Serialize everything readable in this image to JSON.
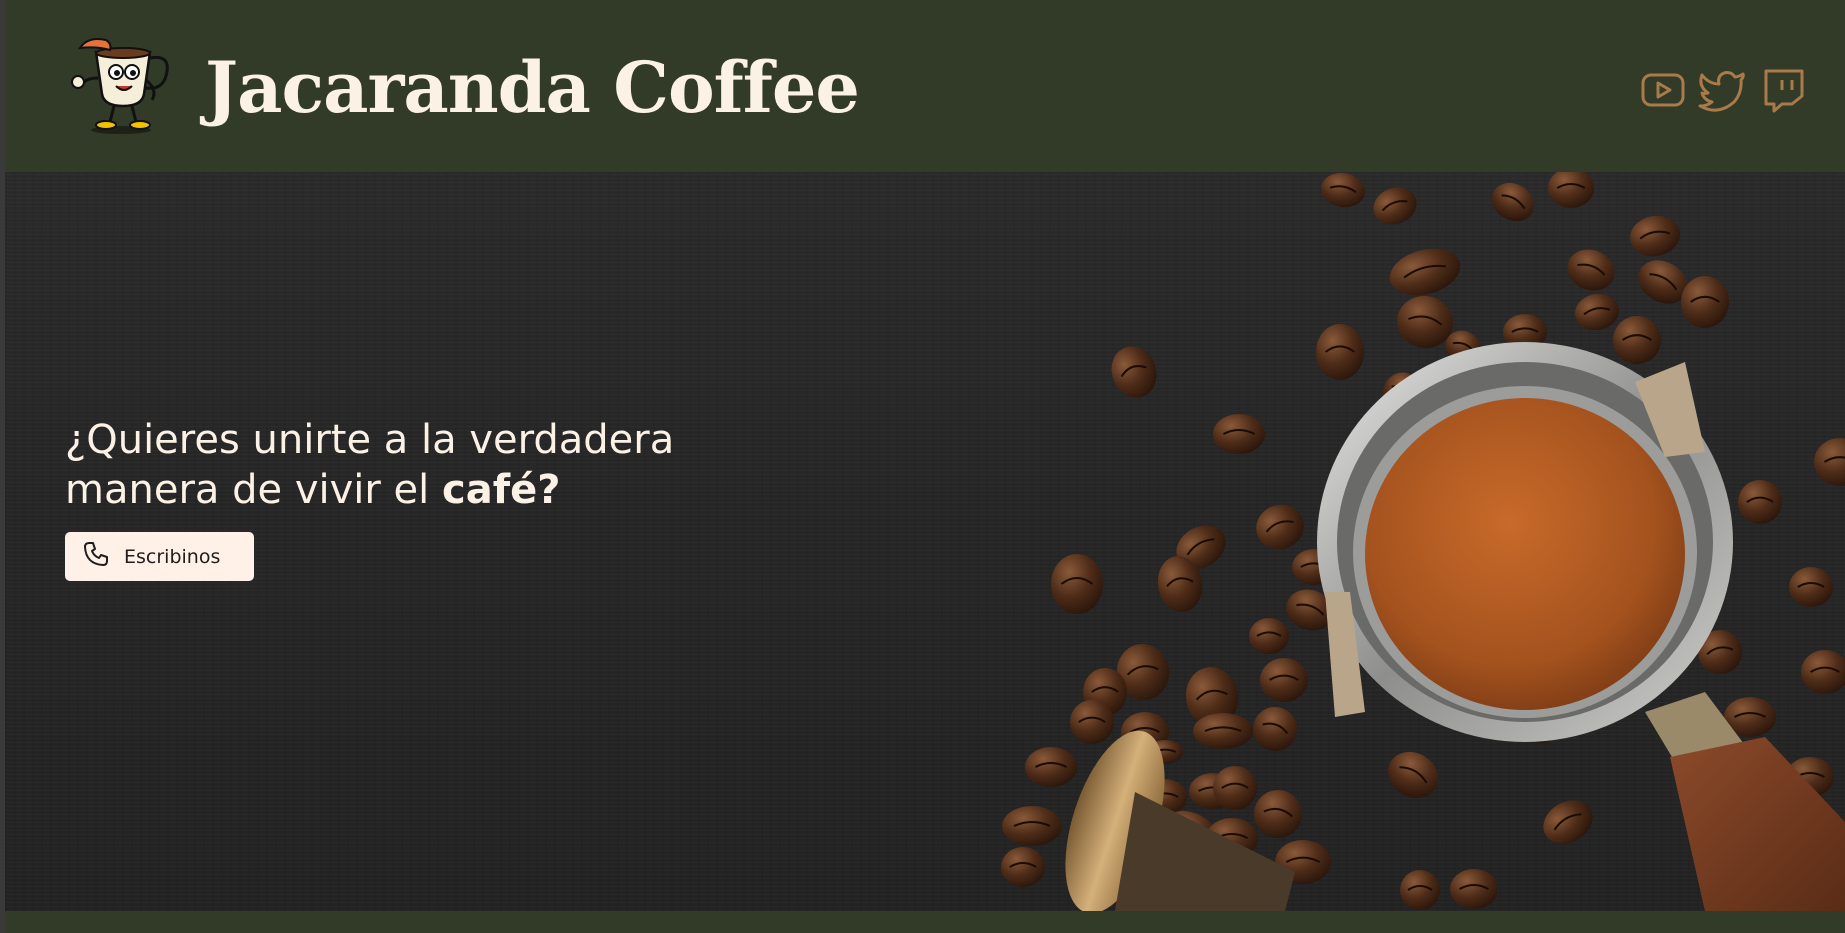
{
  "header": {
    "brand": "Jacaranda Coffee",
    "logo_icon": "coffee-cup-mascot-icon",
    "social": [
      {
        "name": "youtube",
        "icon": "youtube-icon"
      },
      {
        "name": "twitter",
        "icon": "twitter-icon"
      },
      {
        "name": "twitch",
        "icon": "twitch-icon"
      }
    ]
  },
  "hero": {
    "line1": "¿Quieres unirte a la verdadera",
    "line2_prefix": "manera de vivir el ",
    "line2_bold": "café?",
    "cta_label": "Escribinos",
    "cta_icon": "phone-icon"
  },
  "colors": {
    "header_bg": "#323a28",
    "brand_text": "#fbf1e4",
    "social_icon": "#a97a4a",
    "cta_bg": "#fff1e7"
  }
}
